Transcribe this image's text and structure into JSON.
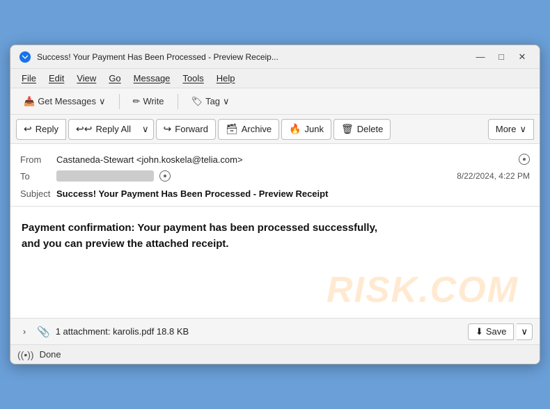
{
  "window": {
    "title": "Success! Your Payment Has Been Processed - Preview Receip...",
    "icon_color": "#1a73e8"
  },
  "titlebar": {
    "minimize_label": "—",
    "maximize_label": "□",
    "close_label": "✕"
  },
  "menubar": {
    "items": [
      "File",
      "Edit",
      "View",
      "Go",
      "Message",
      "Tools",
      "Help"
    ]
  },
  "toolbar": {
    "get_messages_label": "Get Messages",
    "write_label": "Write",
    "tag_label": "Tag"
  },
  "actionbar": {
    "reply_label": "Reply",
    "reply_all_label": "Reply All",
    "forward_label": "Forward",
    "archive_label": "Archive",
    "junk_label": "Junk",
    "delete_label": "Delete",
    "more_label": "More"
  },
  "email": {
    "from_label": "From",
    "from_name": "Castaneda-Stewart",
    "from_email": "<john.koskela@telia.com>",
    "to_label": "To",
    "to_blurred": true,
    "date": "8/22/2024, 4:22 PM",
    "subject_label": "Subject",
    "subject": "Success! Your Payment Has Been Processed - Preview Receipt",
    "body": "Payment confirmation: Your payment has been processed successfully, and you can preview the attached receipt.",
    "watermark": "RISK.COM"
  },
  "attachment": {
    "expand_icon": "›",
    "clip_icon": "📎",
    "info": "1 attachment: karolis.pdf  18.8 KB",
    "save_label": "Save",
    "dropdown_icon": "∨"
  },
  "statusbar": {
    "icon": "((•))",
    "text": "Done"
  }
}
